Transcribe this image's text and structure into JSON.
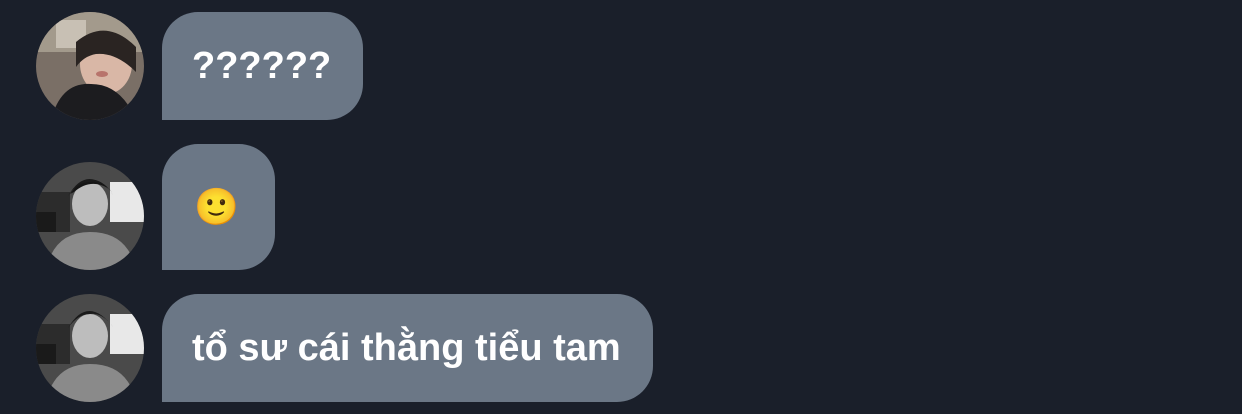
{
  "messages": [
    {
      "sender": "user-1",
      "text": "??????"
    },
    {
      "sender": "user-2",
      "text": "🙂"
    },
    {
      "sender": "user-2",
      "text": "tổ sư cái thằng tiểu tam"
    }
  ],
  "colors": {
    "background": "#1a1f2a",
    "bubble": "#6b7786",
    "bubble_text": "#ffffff"
  }
}
